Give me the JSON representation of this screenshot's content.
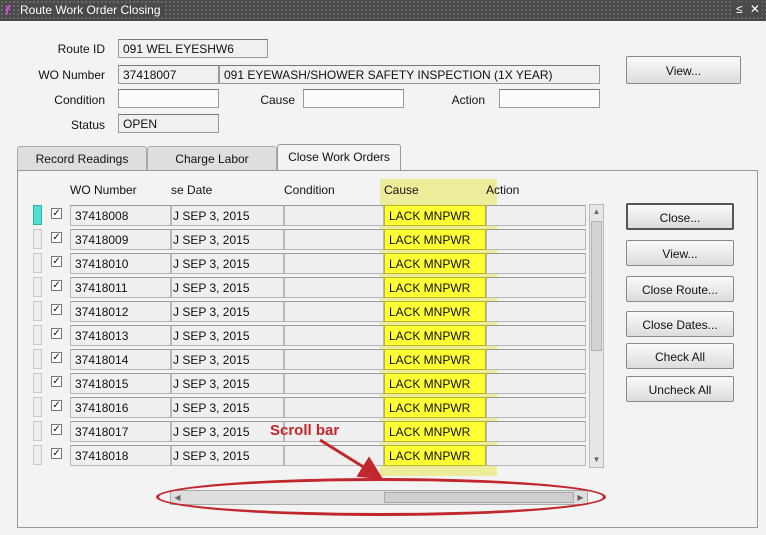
{
  "window": {
    "title": "Route Work Order Closing",
    "app_icon": "oracle-forms-icon",
    "buttons": "≤ ✕"
  },
  "header": {
    "route_id_label": "Route ID",
    "route_id": "091 WEL EYESHW6",
    "wo_number_label": "WO Number",
    "wo_number": "37418007",
    "wo_description": "091 EYEWASH/SHOWER SAFETY INSPECTION (1X YEAR)",
    "condition_label": "Condition",
    "condition": "",
    "cause_label": "Cause",
    "cause": "",
    "action_label": "Action",
    "action": "",
    "status_label": "Status",
    "status": "OPEN",
    "view_button": "View..."
  },
  "tabs": [
    {
      "label": "Record Readings",
      "active": false
    },
    {
      "label": "Charge Labor",
      "active": false
    },
    {
      "label": "Close Work Orders",
      "active": true
    }
  ],
  "table": {
    "headers": {
      "wo_number": "WO Number",
      "close_date": "se Date",
      "condition": "Condition",
      "cause": "Cause",
      "action": "Action"
    },
    "rows": [
      {
        "wo": "37418008",
        "date": "J SEP 3, 2015",
        "condition": "",
        "cause": "LACK MNPWR",
        "action": "",
        "checked": true,
        "current": true
      },
      {
        "wo": "37418009",
        "date": "J SEP 3, 2015",
        "condition": "",
        "cause": "LACK MNPWR",
        "action": "",
        "checked": true,
        "current": false
      },
      {
        "wo": "37418010",
        "date": "J SEP 3, 2015",
        "condition": "",
        "cause": "LACK MNPWR",
        "action": "",
        "checked": true,
        "current": false
      },
      {
        "wo": "37418011",
        "date": "J SEP 3, 2015",
        "condition": "",
        "cause": "LACK MNPWR",
        "action": "",
        "checked": true,
        "current": false
      },
      {
        "wo": "37418012",
        "date": "J SEP 3, 2015",
        "condition": "",
        "cause": "LACK MNPWR",
        "action": "",
        "checked": true,
        "current": false
      },
      {
        "wo": "37418013",
        "date": "J SEP 3, 2015",
        "condition": "",
        "cause": "LACK MNPWR",
        "action": "",
        "checked": true,
        "current": false
      },
      {
        "wo": "37418014",
        "date": "J SEP 3, 2015",
        "condition": "",
        "cause": "LACK MNPWR",
        "action": "",
        "checked": true,
        "current": false
      },
      {
        "wo": "37418015",
        "date": "J SEP 3, 2015",
        "condition": "",
        "cause": "LACK MNPWR",
        "action": "",
        "checked": true,
        "current": false
      },
      {
        "wo": "37418016",
        "date": "J SEP 3, 2015",
        "condition": "",
        "cause": "LACK MNPWR",
        "action": "",
        "checked": true,
        "current": false
      },
      {
        "wo": "37418017",
        "date": "J SEP 3, 2015",
        "condition": "",
        "cause": "LACK MNPWR",
        "action": "",
        "checked": true,
        "current": false
      },
      {
        "wo": "37418018",
        "date": "J SEP 3, 2015",
        "condition": "",
        "cause": "LACK MNPWR",
        "action": "",
        "checked": true,
        "current": false
      }
    ]
  },
  "side_buttons": {
    "close": "Close...",
    "view": "View...",
    "close_route": "Close Route...",
    "close_dates": "Close Dates...",
    "check_all": "Check All",
    "uncheck_all": "Uncheck All"
  },
  "annotation": {
    "label": "Scroll bar",
    "color": "#c1272d"
  },
  "colors": {
    "cause_highlight": "#ffff33",
    "current_row_indicator": "#4fe0d0"
  }
}
